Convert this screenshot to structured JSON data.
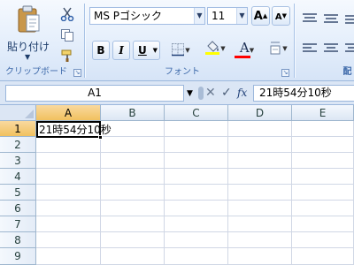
{
  "clipboard": {
    "paste_label": "貼り付け",
    "group_label": "クリップボード",
    "icons": [
      "paste-icon",
      "cut-icon",
      "copy-icon",
      "format-painter-icon"
    ]
  },
  "font": {
    "font_name": "MS Pゴシック",
    "font_size": "11",
    "bold": "B",
    "italic": "I",
    "underline": "U",
    "grow_font": "A",
    "shrink_font": "A",
    "font_color": "A",
    "group_label": "フォント",
    "colors": {
      "font_color_bar": "#ff0000",
      "fill_color_bar": "#ffff00"
    }
  },
  "formula_bar": {
    "name_box": "A1",
    "fx_label": "fx",
    "value": "21時54分10秒"
  },
  "grid": {
    "columns": [
      "A",
      "B",
      "C",
      "D",
      "E"
    ],
    "rows": [
      "1",
      "2",
      "3",
      "4",
      "5",
      "6",
      "7",
      "8",
      "9"
    ],
    "active_cell": "A1",
    "a1_value": "21時54分10秒"
  }
}
